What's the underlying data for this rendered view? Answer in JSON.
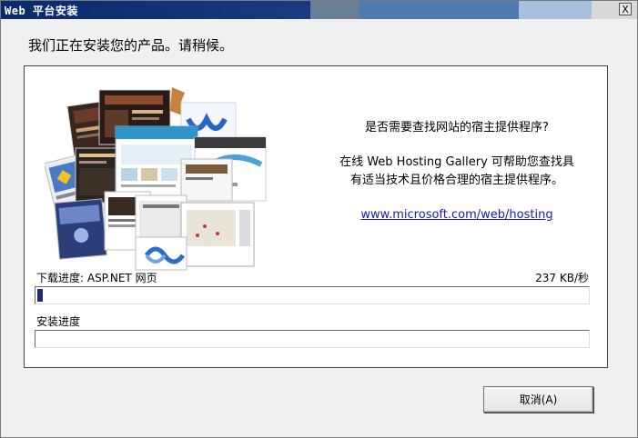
{
  "window": {
    "title": "Web 平台安装",
    "close_glyph": "X",
    "title_colors": [
      "#0b2a6b",
      "#2a4d92",
      "#6a7f96",
      "#4f7bb0",
      "#85a9d8",
      "#b7cbe2"
    ]
  },
  "header": {
    "text": "我们正在安装您的产品。请稍候。"
  },
  "info": {
    "question": "是否需要查找网站的宿主提供程序?",
    "description": "在线 Web Hosting Gallery 可帮助您查找具有适当技术且价格合理的宿主提供程序。",
    "link_text": "www.microsoft.com/web/hosting"
  },
  "download": {
    "label": "下载进度: ASP.NET 网页",
    "speed": "237 KB/秒",
    "progress_percent": 1
  },
  "install": {
    "label": "安装进度",
    "progress_percent": 0
  },
  "footer": {
    "cancel_label": "取消(A)"
  }
}
